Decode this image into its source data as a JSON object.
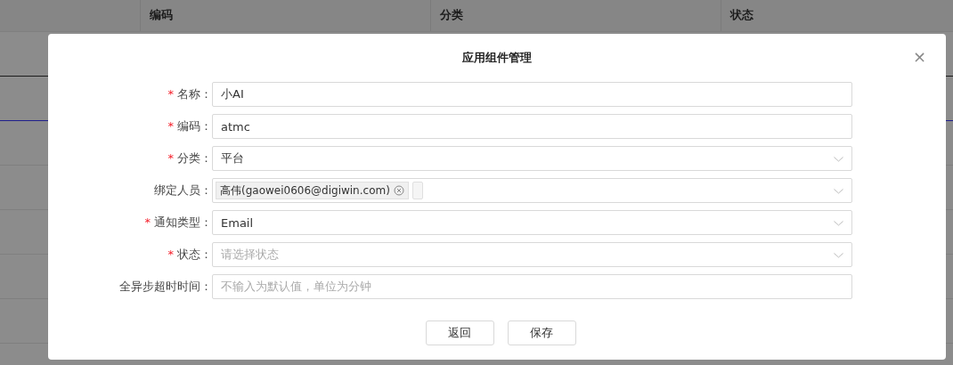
{
  "table": {
    "columns": [
      {
        "label": "编码"
      },
      {
        "label": "分类"
      },
      {
        "label": "状态"
      }
    ]
  },
  "dialog": {
    "title": "应用组件管理",
    "close": "×",
    "required_mark": "*",
    "fields": [
      {
        "label": "名称：",
        "required": true,
        "kind": "text",
        "value": "小AI"
      },
      {
        "label": "编码：",
        "required": true,
        "kind": "text",
        "value": "atmc"
      },
      {
        "label": "分类：",
        "required": true,
        "kind": "select",
        "value": "平台"
      },
      {
        "label": "绑定人员：",
        "required": false,
        "kind": "tags",
        "tags": [
          "高伟(gaowei0606@digiwin.com)"
        ]
      },
      {
        "label": "通知类型：",
        "required": true,
        "kind": "select",
        "value": "Email"
      },
      {
        "label": "状态：",
        "required": true,
        "kind": "select",
        "placeholder": "请选择状态"
      },
      {
        "label": "全异步超时时间：",
        "required": false,
        "kind": "text",
        "placeholder": "不输入为默认值，单位为分钟"
      }
    ],
    "buttons": [
      "返回",
      "保存"
    ]
  }
}
